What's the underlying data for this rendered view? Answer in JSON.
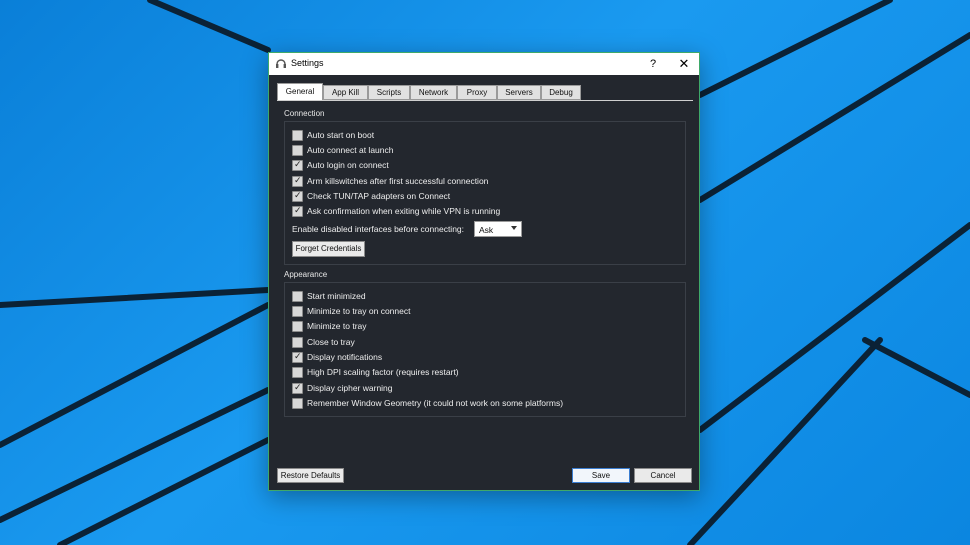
{
  "window": {
    "title": "Settings",
    "help_glyph": "?",
    "close_glyph": "✕",
    "app_icon": "app-icon"
  },
  "tabs": [
    {
      "label": "General",
      "active": true
    },
    {
      "label": "App Kill",
      "active": false
    },
    {
      "label": "Scripts",
      "active": false
    },
    {
      "label": "Network",
      "active": false
    },
    {
      "label": "Proxy",
      "active": false
    },
    {
      "label": "Servers",
      "active": false
    },
    {
      "label": "Debug",
      "active": false
    }
  ],
  "connection": {
    "label": "Connection",
    "options": [
      {
        "label": "Auto start on boot",
        "checked": false
      },
      {
        "label": "Auto connect at launch",
        "checked": false
      },
      {
        "label": "Auto login on connect",
        "checked": true
      },
      {
        "label": "Arm killswitches after first successful connection",
        "checked": true
      },
      {
        "label": "Check TUN/TAP adapters on Connect",
        "checked": true
      },
      {
        "label": "Ask confirmation when exiting while VPN is running",
        "checked": true
      }
    ],
    "interfaces_label": "Enable disabled interfaces before connecting:",
    "interfaces_value": "Ask",
    "forget_credentials": "Forget Credentials"
  },
  "appearance": {
    "label": "Appearance",
    "options": [
      {
        "label": "Start minimized",
        "checked": false
      },
      {
        "label": "Minimize to tray on connect",
        "checked": false
      },
      {
        "label": "Minimize to tray",
        "checked": false
      },
      {
        "label": "Close to tray",
        "checked": false
      },
      {
        "label": "Display notifications",
        "checked": true
      },
      {
        "label": "High DPI scaling factor (requires restart)",
        "checked": false
      },
      {
        "label": "Display cipher warning",
        "checked": true
      },
      {
        "label": "Remember Window Geometry (it could not work on some platforms)",
        "checked": false
      }
    ]
  },
  "footer": {
    "restore_defaults": "Restore Defaults",
    "save": "Save",
    "cancel": "Cancel"
  },
  "colors": {
    "desktop_blue": "#0b86e0",
    "window_bg": "#23272e",
    "accent_border": "#3fa96a"
  },
  "check_glyph": "✓"
}
